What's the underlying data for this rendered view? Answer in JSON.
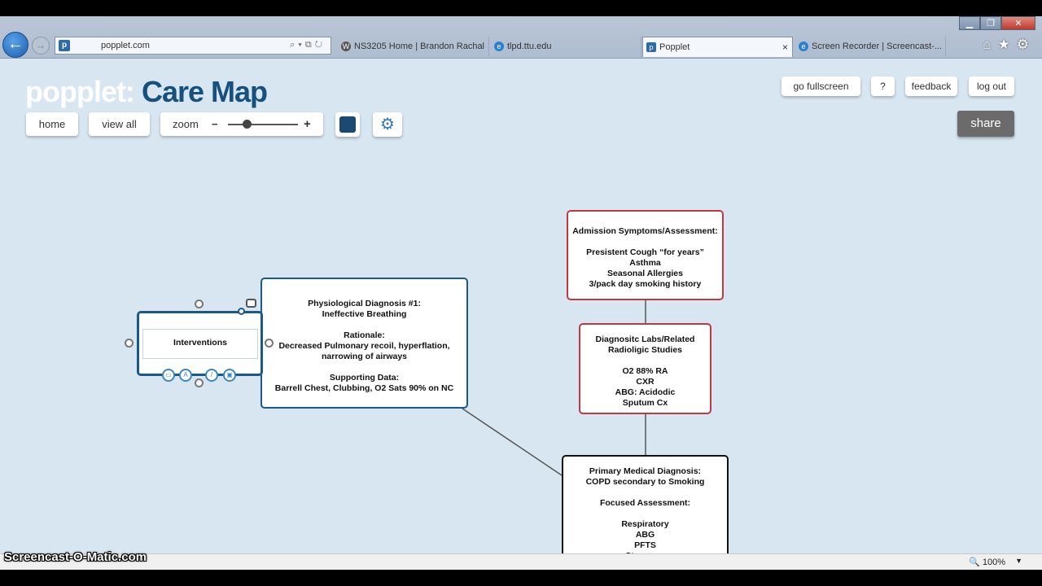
{
  "browser": {
    "url": "popplet.com",
    "tabs": [
      {
        "label": "NS3205 Home | Brandon Rachal",
        "icon": "wordpress-icon"
      },
      {
        "label": "tlpd.ttu.edu",
        "icon": "ie-icon"
      },
      {
        "label": "Popplet",
        "icon": "popplet-icon",
        "active": true
      },
      {
        "label": "Screen Recorder | Screencast-...",
        "icon": "ie-icon"
      }
    ],
    "close_tab": "×",
    "zoom": "100%"
  },
  "app": {
    "logo_part1": "popplet:",
    "logo_part2": "Care Map",
    "buttons": {
      "home": "home",
      "view_all": "view all",
      "zoom": "zoom",
      "zoom_minus": "−",
      "zoom_plus": "+",
      "fullscreen": "go fullscreen",
      "help": "?",
      "feedback": "feedback",
      "logout": "log out",
      "share": "share"
    },
    "accent_color": "#1a4a73"
  },
  "popplets": {
    "intervention": "Interventions",
    "physiological": "Physiological Diagnosis #1:\nIneffective Breathing\n\nRationale:\nDecreased Pulmonary recoil, hyperflation,\nnarrowing of airways\n\nSupporting Data:\nBarrell Chest, Clubbing, O2 Sats 90% on NC",
    "admission": "Admission Symptoms/Assessment:\n\nPresistent Cough “for years”\nAsthma\nSeasonal Allergies\n3/pack day smoking history",
    "labs": "Diagnositc Labs/Related\nRadioligic Studies\n\nO2 88% RA\nCXR\nABG: Acidodic\nSputum Cx",
    "primary": "Primary Medical Diagnosis:\nCOPD secondary to Smoking\n\nFocused Assessment:\n\nRespiratory\nABG\nPFTS\nStressors"
  },
  "colors": {
    "popplet_blue": "#1a5a8a",
    "popplet_red": "#c0393f",
    "popplet_black": "#111111",
    "canvas_bg": "#d8e6f1"
  },
  "watermark": "Screencast-O-Matic.com"
}
